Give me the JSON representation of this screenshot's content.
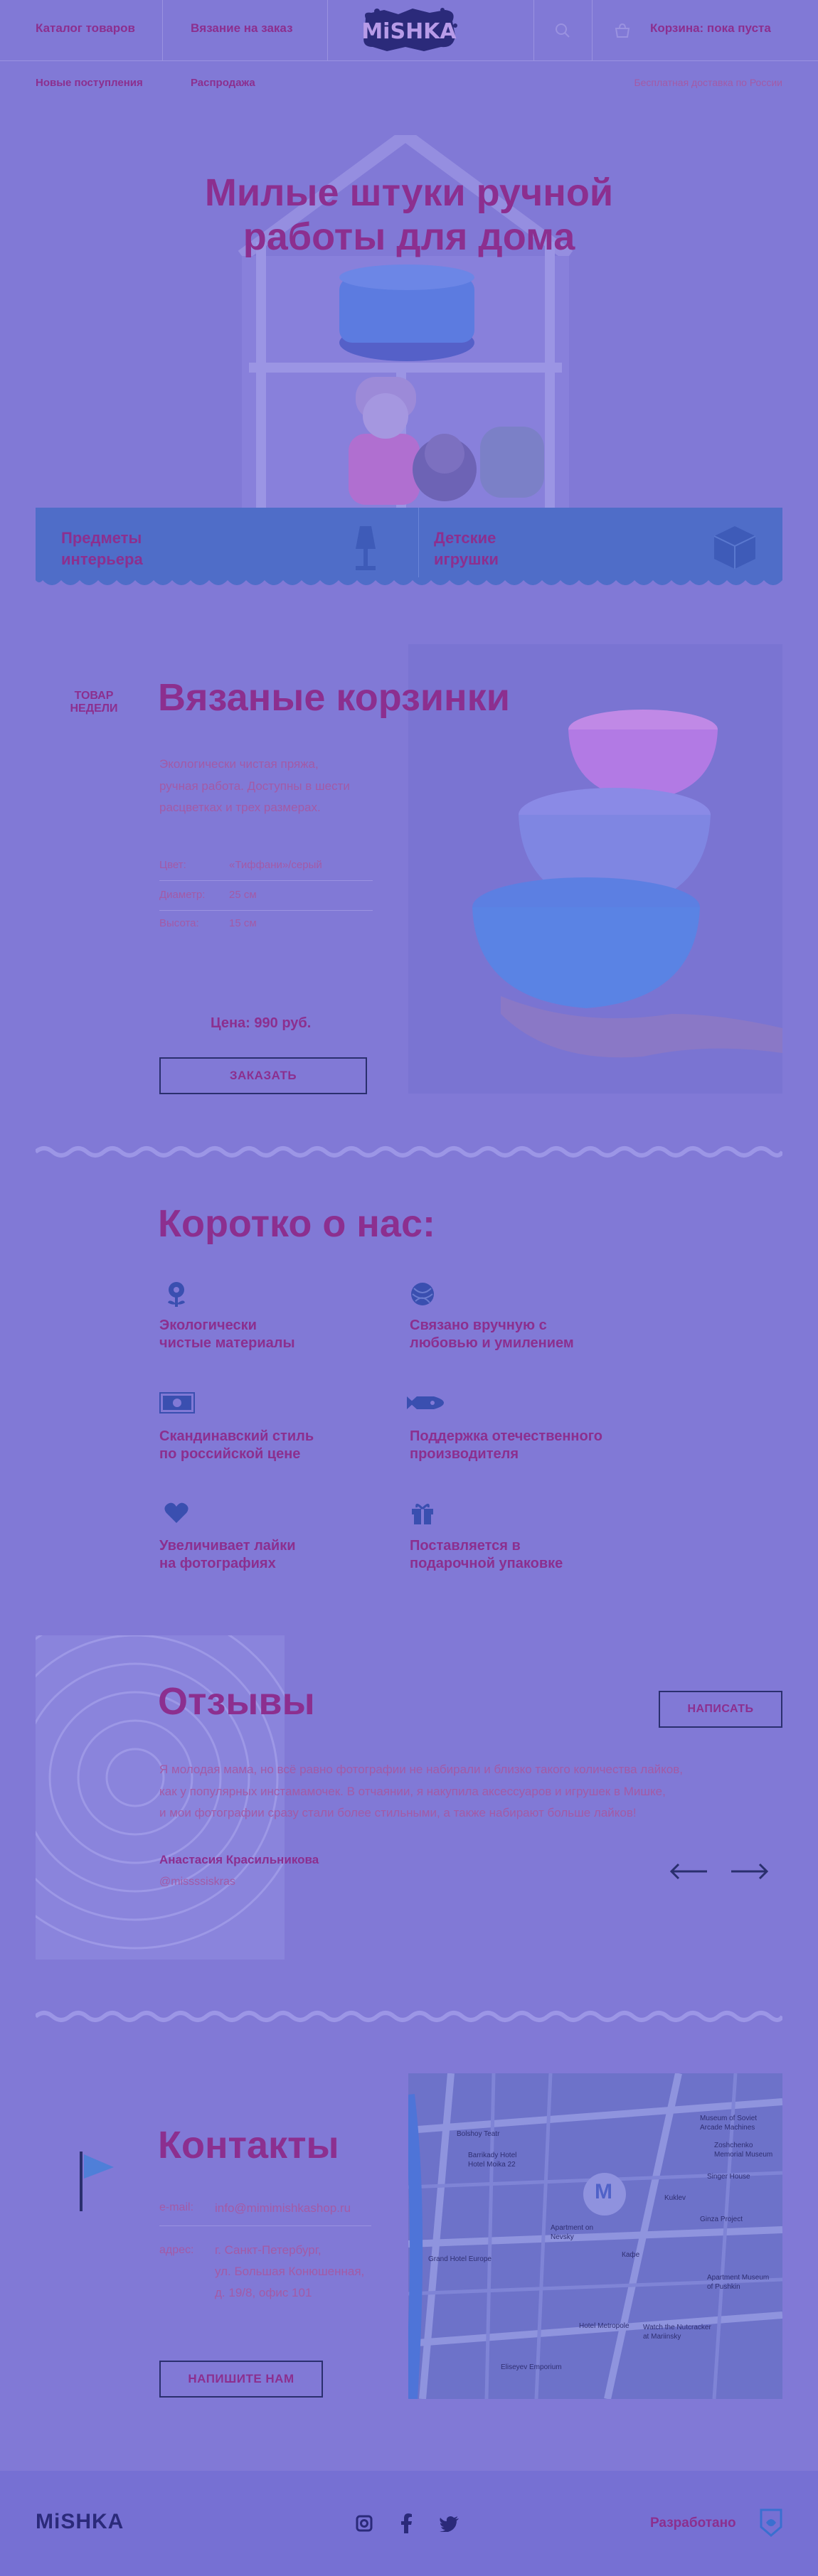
{
  "brand": {
    "logo_text": "MiSHKA"
  },
  "header": {
    "catalog": "Каталог товаров",
    "custom": "Вязание на заказ",
    "cart": "Корзина: пока пуста",
    "new_arrivals": "Новые поступления",
    "sale": "Распродажа",
    "delivery": "Бесплатная доставка по России"
  },
  "hero": {
    "title_line1": "Милые штуки ручной",
    "title_line2": "работы для дома",
    "cat1_line1": "Предметы",
    "cat1_line2": "интерьера",
    "cat2_line1": "Детские",
    "cat2_line2": "игрушки"
  },
  "product": {
    "tag_line1": "ТОВАР",
    "tag_line2": "НЕДЕЛИ",
    "title": "Вязаные корзинки",
    "desc_line1": "Экологически чистая пряжа,",
    "desc_line2": "ручная работа. Доступны в шести",
    "desc_line3": "расцветках и трех размерах.",
    "specs": [
      {
        "label": "Цвет:",
        "value": "«Тиффани»/серый"
      },
      {
        "label": "Диаметр:",
        "value": "25 см"
      },
      {
        "label": "Высота:",
        "value": "15 см"
      }
    ],
    "price": "Цена: 990 руб.",
    "order_button": "ЗАКАЗАТЬ"
  },
  "about": {
    "title": "Коротко о нас:",
    "features": [
      {
        "line1": "Экологически",
        "line2": "чистые материалы",
        "icon": "flower-icon"
      },
      {
        "line1": "Связано вручную с",
        "line2": "любовью и умилением",
        "icon": "yarn-ball-icon"
      },
      {
        "line1": "Скандинавский стиль",
        "line2": "по российской цене",
        "icon": "banknote-icon"
      },
      {
        "line1": "Поддержка отечественного",
        "line2": "производителя",
        "icon": "rocket-icon"
      },
      {
        "line1": "Увеличивает лайки",
        "line2": "на фотографиях",
        "icon": "heart-icon"
      },
      {
        "line1": "Поставляется в",
        "line2": "подарочной упаковке",
        "icon": "gift-icon"
      }
    ]
  },
  "reviews": {
    "title": "Отзывы",
    "write_button": "НАПИСАТЬ",
    "text_line1": "Я молодая мама, но всё равно фотографии не набирали и близко такого количества лайков,",
    "text_line2": "как у популярных инстамамочек. В отчаянии, я накупила аксессуаров и игрушек в Мишке,",
    "text_line3": "и мои фотографии сразу стали более стильными, а также набирают больше лайков!",
    "author": "Анастасия Красильникова",
    "handle": "@missssiskras"
  },
  "contacts": {
    "title": "Контакты",
    "email_label": "e-mail:",
    "email": "info@mimimishkashop.ru",
    "address_label": "адрес:",
    "address_line1": "г. Санкт-Петербург,",
    "address_line2": "ул. Большая Конюшенная,",
    "address_line3": "д. 19/8, офис 101",
    "button": "НАПИШИТЕ НАМ"
  },
  "map": {
    "labels": [
      "Museum of Soviet",
      "Arcade Machines",
      "Zoshchenko",
      "Memorial Museum",
      "Singer House",
      "Bolshoy Teatr",
      "Kuklev",
      "Ginza Project",
      "Apartment on",
      "Nevsky",
      "Grand Hotel Europe",
      "Hotel Metropole",
      "Apartment Museum",
      "of Pushkin",
      "Watch the Nutcracker",
      "at Mariinsky",
      "Eliseyev Emporium",
      "Кафе",
      "Barrikady Hotel",
      "Hotel Moika 22"
    ],
    "pin_letter": "M"
  },
  "footer": {
    "credit": "Разработано"
  }
}
